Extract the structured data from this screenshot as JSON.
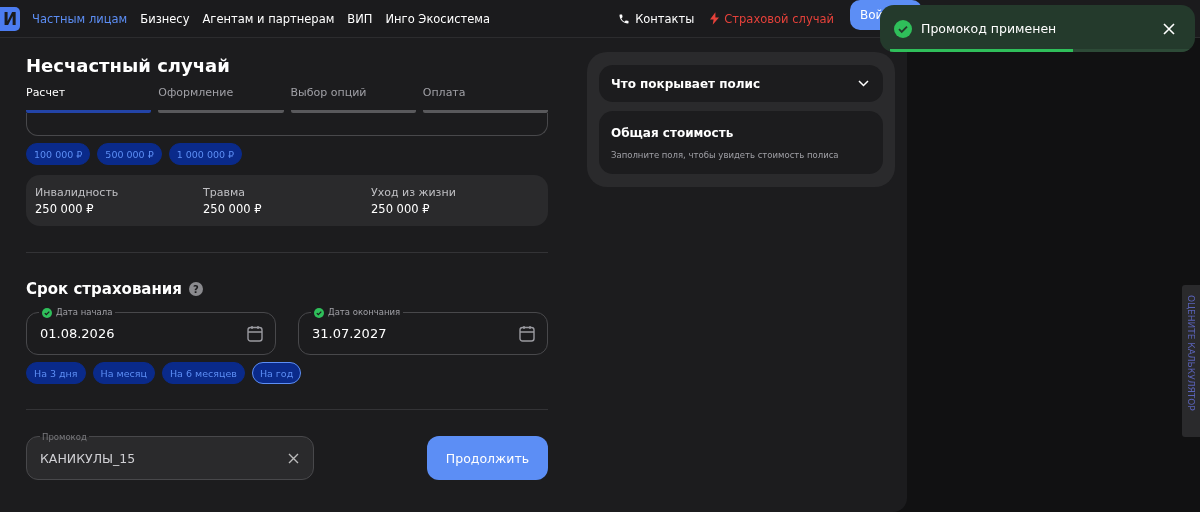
{
  "header": {
    "logo": "И",
    "nav": [
      {
        "label": "Частным лицам",
        "selected": true
      },
      {
        "label": "Бизнесу",
        "selected": false
      },
      {
        "label": "Агентам и партнерам",
        "selected": false
      },
      {
        "label": "ВИП",
        "selected": false
      },
      {
        "label": "Инго Экосистема",
        "selected": false
      }
    ],
    "links": [
      {
        "kind": "phone",
        "label": "Контакты"
      },
      {
        "kind": "alert",
        "label": "Страховой случай"
      }
    ],
    "login_button": "Вой"
  },
  "title": "Несчастный случай",
  "steps": [
    {
      "label": "Расчет",
      "selected": true
    },
    {
      "label": "Оформление",
      "selected": false
    },
    {
      "label": "Выбор опций",
      "selected": false
    },
    {
      "label": "Оплата",
      "selected": false
    }
  ],
  "amount_chips": [
    {
      "label": "100 000 ₽",
      "selected": false
    },
    {
      "label": "500 000 ₽",
      "selected": false
    },
    {
      "label": "1 000 000 ₽",
      "selected": false
    }
  ],
  "coverage": [
    {
      "label": "Инвалидность",
      "value": "250 000 ₽"
    },
    {
      "label": "Травма",
      "value": "250 000 ₽"
    },
    {
      "label": "Уход из жизни",
      "value": "250 000 ₽"
    }
  ],
  "term": {
    "title": "Срок страхования",
    "help": "?",
    "fields": [
      {
        "label": "Дата начала",
        "value": "01.08.2026",
        "valid": true
      },
      {
        "label": "Дата окончания",
        "value": "31.07.2027",
        "valid": true
      }
    ],
    "chips": [
      {
        "label": "На 3 дня",
        "selected": false
      },
      {
        "label": "На месяц",
        "selected": false
      },
      {
        "label": "На 6 месяцев",
        "selected": false
      },
      {
        "label": "На год",
        "selected": true
      }
    ]
  },
  "promo": {
    "label": "Промокод",
    "value": "КАНИКУЛЫ_15"
  },
  "continue_button": "Продолжить",
  "summary": {
    "coverage_title": "Что покрывает полис",
    "expanded": false,
    "cost_title": "Общая стоимость",
    "cost_hint": "Заполните поля, чтобы увидеть стоимость полиса"
  },
  "toast": {
    "message": "Промокод применен",
    "level": 0.6
  },
  "side_tab": "ОЦЕНИТЕ КАЛЬКУЛЯТОР"
}
